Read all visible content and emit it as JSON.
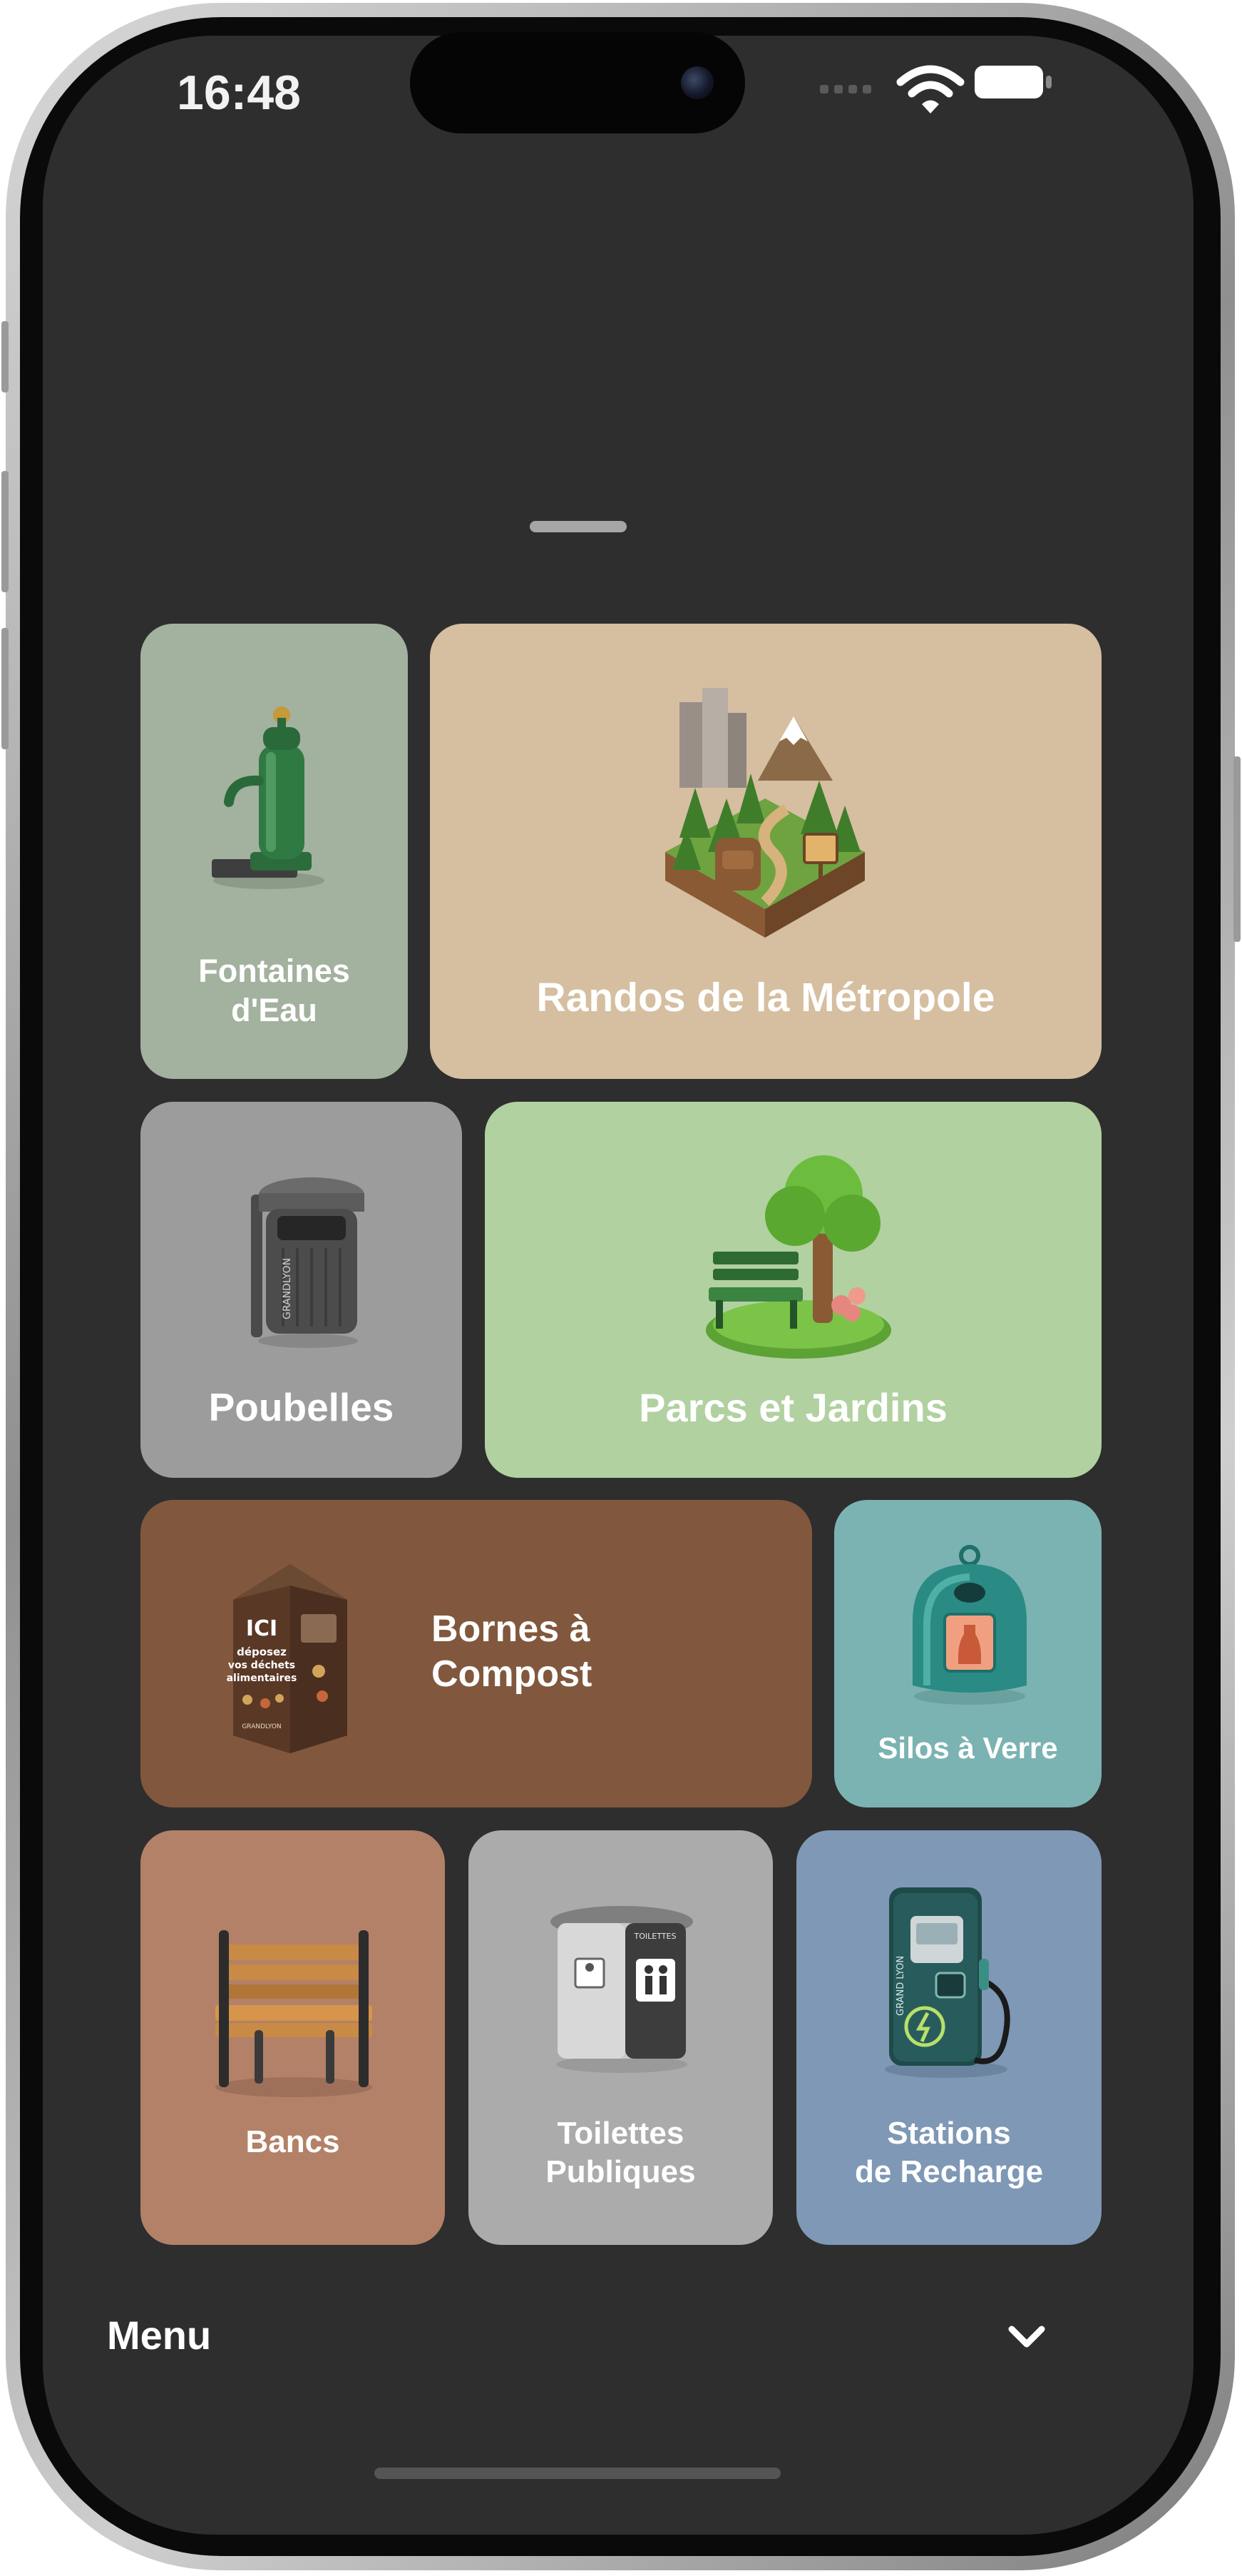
{
  "status_bar": {
    "time": "16:48"
  },
  "tiles": {
    "fontaines": {
      "label_line1": "Fontaines",
      "label_line2": "d'Eau",
      "color": "#a3b19f"
    },
    "randos": {
      "label": "Randos de la Métropole",
      "color": "#d5bfa0"
    },
    "poubelles": {
      "label": "Poubelles",
      "color": "#9c9c9c"
    },
    "parcs": {
      "label": "Parcs et Jardins",
      "color": "#b1d1a0"
    },
    "compost": {
      "label_line1": "Bornes à",
      "label_line2": "Compost",
      "color": "#81583d",
      "bin_text": [
        "ICI",
        "déposez",
        "vos déchets",
        "alimentaires",
        "GRANDLYON"
      ]
    },
    "silos": {
      "label": "Silos à Verre",
      "color": "#7bb3b2"
    },
    "bancs": {
      "label": "Bancs",
      "color": "#b38167"
    },
    "toilettes": {
      "label_line1": "Toilettes",
      "label_line2": "Publiques",
      "color": "#ababab",
      "kiosk_text": "TOILETTES"
    },
    "stations": {
      "label_line1": "Stations",
      "label_line2": "de Recharge",
      "color": "#7e98b5",
      "charger_text": "GRAND LYON"
    },
    "poubelle_bin_text": "GRANDLYON"
  },
  "menu": {
    "label": "Menu"
  },
  "icons": {
    "wifi": "wifi-icon",
    "battery": "battery-icon",
    "chevron": "chevron-down-icon"
  }
}
